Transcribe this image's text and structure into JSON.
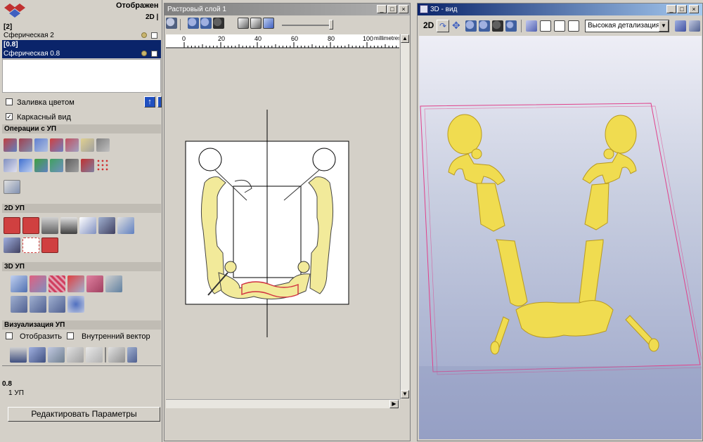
{
  "left_panel": {
    "header_title": "Отображен",
    "header_mode": "2D |",
    "layers": [
      {
        "tag": "[2]",
        "name": "Сферическая 2",
        "selected": false
      },
      {
        "tag": "[0.8]",
        "name": "Сферическая 0.8",
        "selected": true
      }
    ],
    "fill_color_label": "Заливка цветом",
    "fill_color_checked": false,
    "wireframe_label": "Каркасный вид",
    "wireframe_checked": true,
    "sections": {
      "ops": "Операции с УП",
      "two_d": "2D УП",
      "three_d": "3D УП",
      "vis": "Визуализация УП"
    },
    "show_label": "Отобразить",
    "inner_vector_label": "Внутренний вектор",
    "status_value": "0.8",
    "status_count": "1 УП",
    "edit_button": "Редактировать Параметры"
  },
  "raster_window": {
    "title": "Растровый слой 1",
    "ruler_ticks": [
      "0",
      "20",
      "40",
      "60",
      "80",
      "100"
    ],
    "ruler_unit": "millimetres"
  },
  "view3d_window": {
    "title": "3D - вид",
    "mode_label": "2D",
    "detail_select": "Высокая детализация"
  },
  "colors": {
    "titlebar_active": "#0a246a",
    "titlebar_inactive": "#808080",
    "model_yellow": "#f0dc50",
    "bbox_pink": "#e0408a"
  }
}
